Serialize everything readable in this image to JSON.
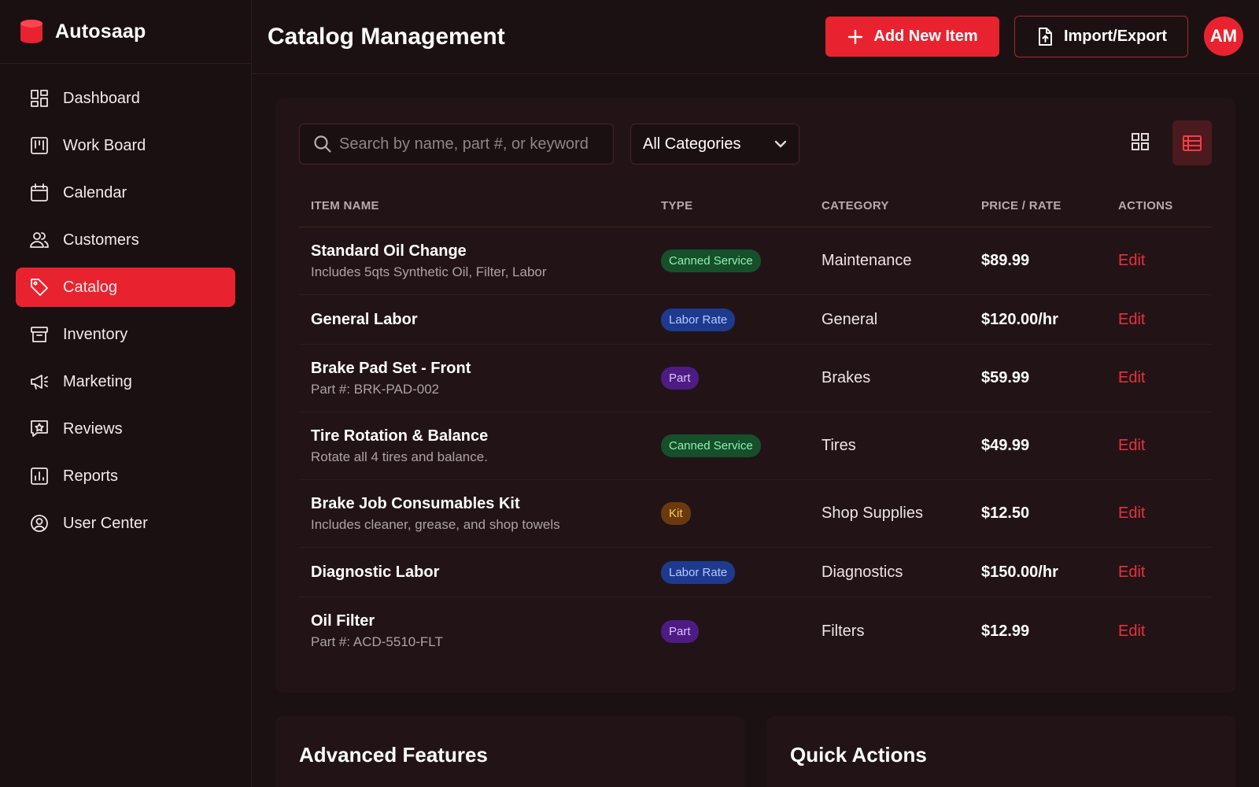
{
  "brand": {
    "name": "Autosaap"
  },
  "colors": {
    "accent": "#e8232f",
    "background": "#1c1112",
    "card": "#221416"
  },
  "sidebar": {
    "items": [
      {
        "label": "Dashboard",
        "icon": "dashboard-icon"
      },
      {
        "label": "Work Board",
        "icon": "kanban-icon"
      },
      {
        "label": "Calendar",
        "icon": "calendar-icon"
      },
      {
        "label": "Customers",
        "icon": "users-icon"
      },
      {
        "label": "Catalog",
        "icon": "tag-icon",
        "active": true
      },
      {
        "label": "Inventory",
        "icon": "archive-icon"
      },
      {
        "label": "Marketing",
        "icon": "megaphone-icon"
      },
      {
        "label": "Reviews",
        "icon": "star-message-icon"
      },
      {
        "label": "Reports",
        "icon": "bar-chart-icon"
      },
      {
        "label": "User Center",
        "icon": "user-circle-icon"
      }
    ]
  },
  "header": {
    "title": "Catalog Management",
    "add_label": "Add New Item",
    "import_label": "Import/Export",
    "avatar_initials": "AM"
  },
  "filters": {
    "search_placeholder": "Search by name, part #, or keyword",
    "search_value": "",
    "category_selected": "All Categories"
  },
  "table": {
    "headers": {
      "name": "ITEM NAME",
      "type": "TYPE",
      "category": "CATEGORY",
      "price": "PRICE / RATE",
      "actions": "ACTIONS"
    },
    "rows": [
      {
        "name": "Standard Oil Change",
        "sub": "Includes 5qts Synthetic Oil, Filter, Labor",
        "type": "Canned Service",
        "type_color": "green",
        "category": "Maintenance",
        "price": "$89.99",
        "action": "Edit"
      },
      {
        "name": "General Labor",
        "sub": "",
        "type": "Labor Rate",
        "type_color": "blue",
        "category": "General",
        "price": "$120.00/hr",
        "action": "Edit"
      },
      {
        "name": "Brake Pad Set - Front",
        "sub": "Part #: BRK-PAD-002",
        "type": "Part",
        "type_color": "purple",
        "category": "Brakes",
        "price": "$59.99",
        "action": "Edit"
      },
      {
        "name": "Tire Rotation & Balance",
        "sub": "Rotate all 4 tires and balance.",
        "type": "Canned Service",
        "type_color": "green",
        "category": "Tires",
        "price": "$49.99",
        "action": "Edit"
      },
      {
        "name": "Brake Job Consumables Kit",
        "sub": "Includes cleaner, grease, and shop towels",
        "type": "Kit",
        "type_color": "amber",
        "category": "Shop Supplies",
        "price": "$12.50",
        "action": "Edit"
      },
      {
        "name": "Diagnostic Labor",
        "sub": "",
        "type": "Labor Rate",
        "type_color": "blue",
        "category": "Diagnostics",
        "price": "$150.00/hr",
        "action": "Edit"
      },
      {
        "name": "Oil Filter",
        "sub": "Part #: ACD-5510-FLT",
        "type": "Part",
        "type_color": "purple",
        "category": "Filters",
        "price": "$12.99",
        "action": "Edit"
      }
    ]
  },
  "bottom": {
    "advanced_title": "Advanced Features",
    "quick_title": "Quick Actions"
  }
}
